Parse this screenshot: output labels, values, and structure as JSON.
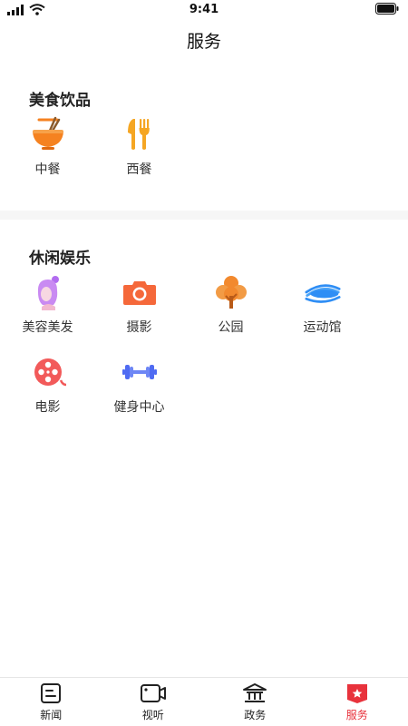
{
  "status_bar": {
    "time": "9:41"
  },
  "header": {
    "title": "服务"
  },
  "sections": [
    {
      "title": "美食饮品",
      "items": [
        {
          "label": "中餐",
          "icon": "noodle-bowl-icon"
        },
        {
          "label": "西餐",
          "icon": "fork-knife-icon"
        }
      ]
    },
    {
      "title": "休闲娱乐",
      "items": [
        {
          "label": "美容美发",
          "icon": "beauty-hair-icon"
        },
        {
          "label": "摄影",
          "icon": "camera-icon"
        },
        {
          "label": "公园",
          "icon": "tree-icon"
        },
        {
          "label": "运动馆",
          "icon": "stadium-icon"
        },
        {
          "label": "电影",
          "icon": "film-reel-icon"
        },
        {
          "label": "健身中心",
          "icon": "dumbbell-icon"
        }
      ]
    }
  ],
  "tabbar": {
    "items": [
      {
        "label": "新闻",
        "icon": "news-icon"
      },
      {
        "label": "视听",
        "icon": "video-icon"
      },
      {
        "label": "政务",
        "icon": "government-icon"
      },
      {
        "label": "服务",
        "icon": "service-icon"
      }
    ],
    "active": "服务"
  },
  "colors": {
    "accent": "#e8323c",
    "orange": "#f58220",
    "purple": "#b26cf0",
    "blue": "#2f8ef5"
  }
}
